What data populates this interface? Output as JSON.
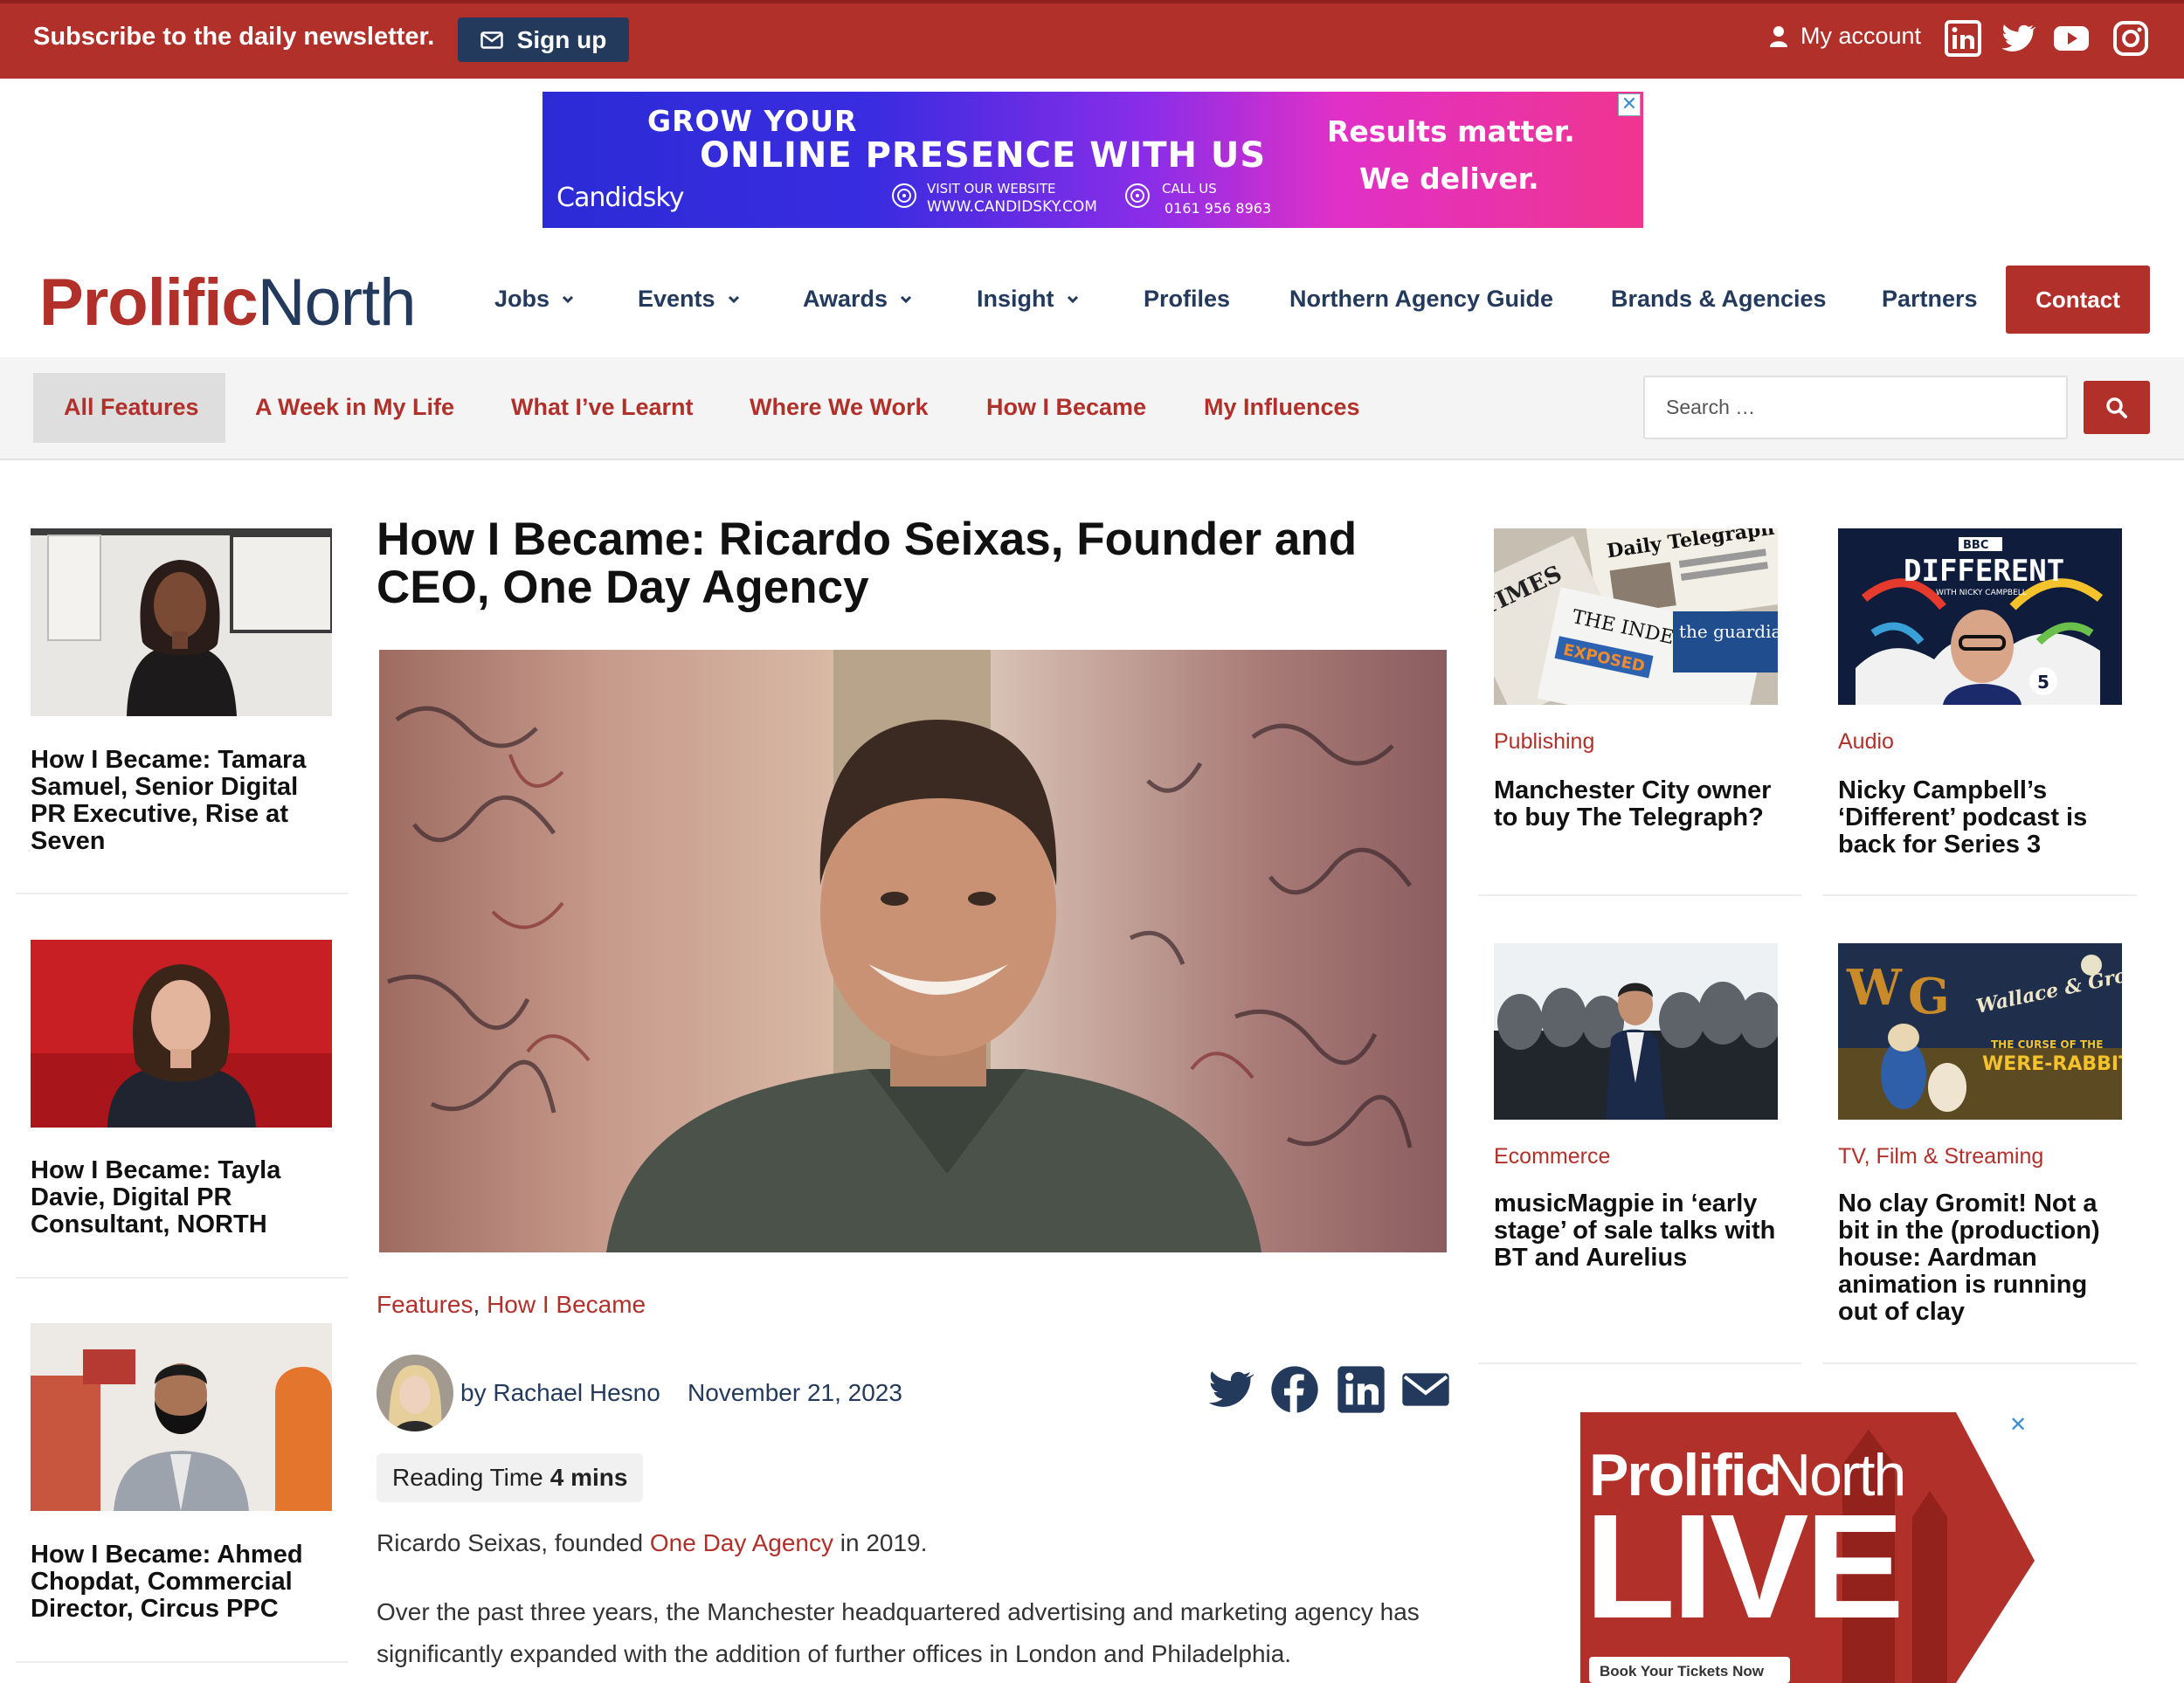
{
  "topbar": {
    "subscribe_text": "Subscribe to the daily newsletter.",
    "signup_label": "Sign up",
    "account_label": "My account",
    "social": [
      "linkedin-icon",
      "twitter-icon",
      "youtube-icon",
      "instagram-icon"
    ]
  },
  "ad": {
    "line1": "GROW YOUR",
    "line2": "ONLINE PRESENCE WITH US",
    "brand": "Candidsky",
    "visit_label": "VISIT OUR WEBSITE",
    "visit_url": "WWW.CANDIDSKY.COM",
    "call_label": "CALL US",
    "call_number": "0161 956 8963",
    "tag1": "Results matter.",
    "tag2": "We deliver.",
    "close": "✕"
  },
  "header": {
    "logo_part1": "Prolific",
    "logo_part2": "North",
    "nav": {
      "jobs": "Jobs",
      "events": "Events",
      "awards": "Awards",
      "insight": "Insight",
      "profiles": "Profiles",
      "agency_guide": "Northern Agency Guide",
      "brands": "Brands & Agencies",
      "partners": "Partners",
      "contact": "Contact"
    }
  },
  "subnav": {
    "items": [
      "All Features",
      "A Week in My Life",
      "What I’ve Learnt",
      "Where We Work",
      "How I Became",
      "My Influences"
    ],
    "search_placeholder": "Search …"
  },
  "left_cards": [
    {
      "title": "How I Became: Tamara Samuel, Senior Digital PR Executive, Rise at Seven"
    },
    {
      "title": "How I Became: Tayla Davie, Digital PR Consultant, NORTH"
    },
    {
      "title": "How I Became: Ahmed Chopdat, Commercial Director, Circus PPC"
    }
  ],
  "article": {
    "title": "How I Became: Ricardo Seixas, Founder and CEO, One Day Agency",
    "category1": "Features",
    "comma": ",",
    "category2": "How I Became",
    "byline": "by Rachael Hesno",
    "date": "November 21, 2023",
    "reading_label": "Reading Time",
    "reading_value": "4 mins",
    "p1_before": "Ricardo Seixas, founded ",
    "p1_link": "One Day Agency",
    "p1_after": " in 2019.",
    "p2": "Over the past three years, the Manchester headquartered advertising and marketing agency has significantly expanded with the addition of further offices in London and Philadelphia."
  },
  "right_cards": [
    {
      "category": "Publishing",
      "title": "Manchester City owner to buy The Telegraph?"
    },
    {
      "category": "Audio",
      "title": "Nicky Campbell’s ‘Different’ podcast is back for Series 3"
    },
    {
      "category": "Ecommerce",
      "title": "musicMagpie in ‘early stage’ of sale talks with BT and Aurelius"
    },
    {
      "category": "TV, Film & Streaming",
      "title": "No clay Gromit! Not a bit in the (production) house: Aardman animation is running out of clay"
    }
  ],
  "thumb_text": {
    "papers": [
      "Daily Telegraph",
      "TIMES",
      "THE INDEPENDENT",
      "EXPOSED",
      "the guardian"
    ],
    "podcast": [
      "BBC",
      "DIFFERENT",
      "WITH NICKY CAMPBELL",
      "5"
    ],
    "film": [
      "W",
      "G",
      "Wallace & Gromit",
      "THE CURSE OF THE",
      "WERE-RABBIT"
    ]
  },
  "live_ad": {
    "logo_part1": "Prolific",
    "logo_part2": "North",
    "word": "LIVE",
    "cta": "Book Your Tickets Now",
    "close": "✕"
  },
  "colors": {
    "brand_red": "#b1302a",
    "navy": "#233a5c"
  }
}
